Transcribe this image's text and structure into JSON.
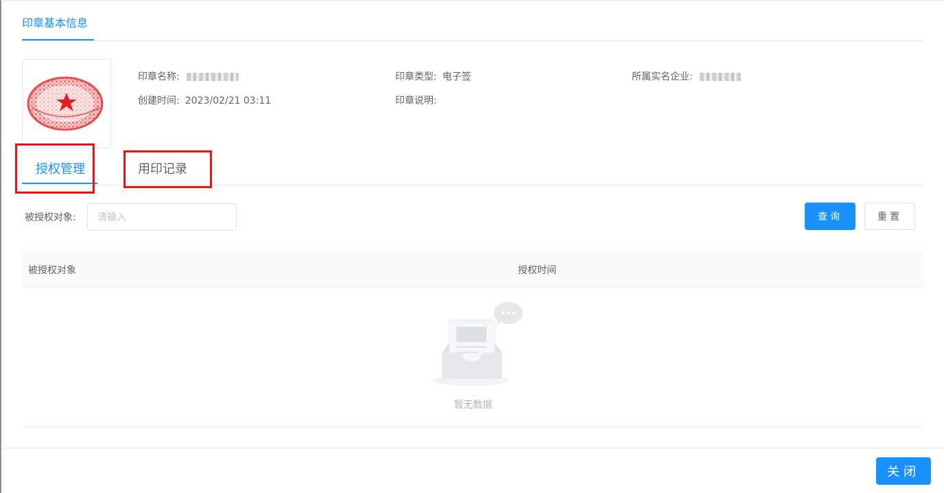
{
  "section": {
    "title": "印章基本信息"
  },
  "seal_info": {
    "name_label": "印章名称:",
    "type_label": "印章类型:",
    "type_value": "电子签",
    "company_label": "所属实名企业:",
    "created_label": "创建时间:",
    "created_value": "2023/02/21 03:11",
    "desc_label": "印章说明:",
    "desc_value": ""
  },
  "tabs": [
    {
      "label": "授权管理",
      "active": true
    },
    {
      "label": "用印记录",
      "active": false
    }
  ],
  "filter": {
    "label": "被授权对象:",
    "placeholder": "请输入",
    "value": "",
    "query_button": "查询",
    "reset_button": "重置"
  },
  "table": {
    "columns": [
      "被授权对象",
      "授权时间"
    ],
    "rows": [],
    "empty_text": "暂无数据"
  },
  "footer": {
    "close_button": "关闭"
  },
  "colors": {
    "accent": "#1890ff",
    "highlight_box": "#ee1111",
    "seal": "#e02020"
  },
  "icons": {
    "empty": "empty-inbox-icon",
    "seal": "seal-stamp-icon"
  }
}
